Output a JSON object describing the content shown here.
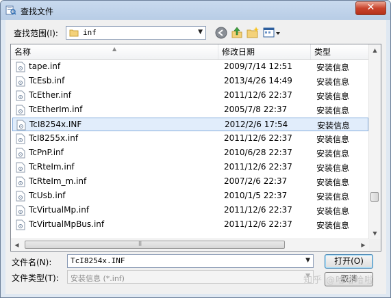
{
  "window": {
    "title": "查找文件",
    "close_symbol": "✕"
  },
  "lookin": {
    "label": "查找范围(I):",
    "value": "inf"
  },
  "toolbar": {
    "back_icon": "back-arrow-icon",
    "up_icon": "up-folder-icon",
    "new_icon": "new-folder-icon",
    "view_icon": "view-menu-icon"
  },
  "list": {
    "columns": {
      "name": "名称",
      "date": "修改日期",
      "type": "类型"
    },
    "rows": [
      {
        "name": "tape.inf",
        "date": "2009/7/14 12:51",
        "type": "安装信息"
      },
      {
        "name": "TcEsb.inf",
        "date": "2013/4/26 14:49",
        "type": "安装信息"
      },
      {
        "name": "TcEther.inf",
        "date": "2011/12/6 22:37",
        "type": "安装信息"
      },
      {
        "name": "TcEtherIm.inf",
        "date": "2005/7/8 22:37",
        "type": "安装信息"
      },
      {
        "name": "TcI8254x.INF",
        "date": "2012/2/6 17:54",
        "type": "安装信息",
        "selected": true
      },
      {
        "name": "TcI8255x.inf",
        "date": "2011/12/6 22:37",
        "type": "安装信息"
      },
      {
        "name": "TcPnP.inf",
        "date": "2010/6/28 22:37",
        "type": "安装信息"
      },
      {
        "name": "TcRteIm.inf",
        "date": "2011/12/6 22:37",
        "type": "安装信息"
      },
      {
        "name": "TcRteIm_m.inf",
        "date": "2007/2/6 22:37",
        "type": "安装信息"
      },
      {
        "name": "TcUsb.inf",
        "date": "2010/1/5 22:37",
        "type": "安装信息"
      },
      {
        "name": "TcVirtualMp.inf",
        "date": "2011/12/6 22:37",
        "type": "安装信息"
      },
      {
        "name": "TcVirtualMpBus.inf",
        "date": "2011/12/6 22:37",
        "type": "安装信息"
      }
    ]
  },
  "filename": {
    "label": "文件名(N):",
    "value": "TcI8254x.INF"
  },
  "filetype": {
    "label": "文件类型(T):",
    "value": "安装信息 (*.inf)"
  },
  "buttons": {
    "open": "打开(O)",
    "cancel": "取消"
  },
  "watermark": "知乎 @哈哈哈啦",
  "colors": {
    "selection_bg": "#e1edfb",
    "selection_border": "#84acdd",
    "titlebar": "#c9daee"
  }
}
